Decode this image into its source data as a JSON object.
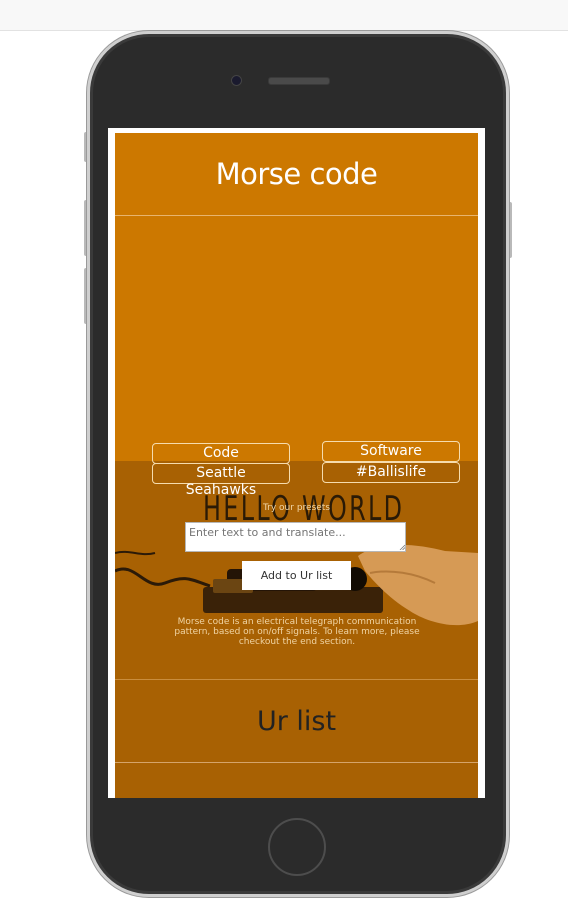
{
  "app": {
    "title": "Morse code",
    "presets_label": "Try our presets",
    "presets": [
      "Code",
      "Software",
      "Seattle Seahawks",
      "#Ballislife"
    ],
    "input": {
      "placeholder": "Enter text to and translate...",
      "value": ""
    },
    "add_button": "Add to Ur list",
    "description": "Morse code is an electrical telegraph communication pattern, based on on/off signals. To learn more, please checkout the end section.",
    "hero_text": "HELLO WORLD",
    "list_title": "Ur list"
  },
  "colors": {
    "primary": "#cc7800",
    "dark": "#a86103",
    "text_light": "#ffffff"
  },
  "icons": {
    "camera": "front-camera-icon",
    "speaker": "earpiece-speaker-icon",
    "home": "home-button-icon"
  }
}
